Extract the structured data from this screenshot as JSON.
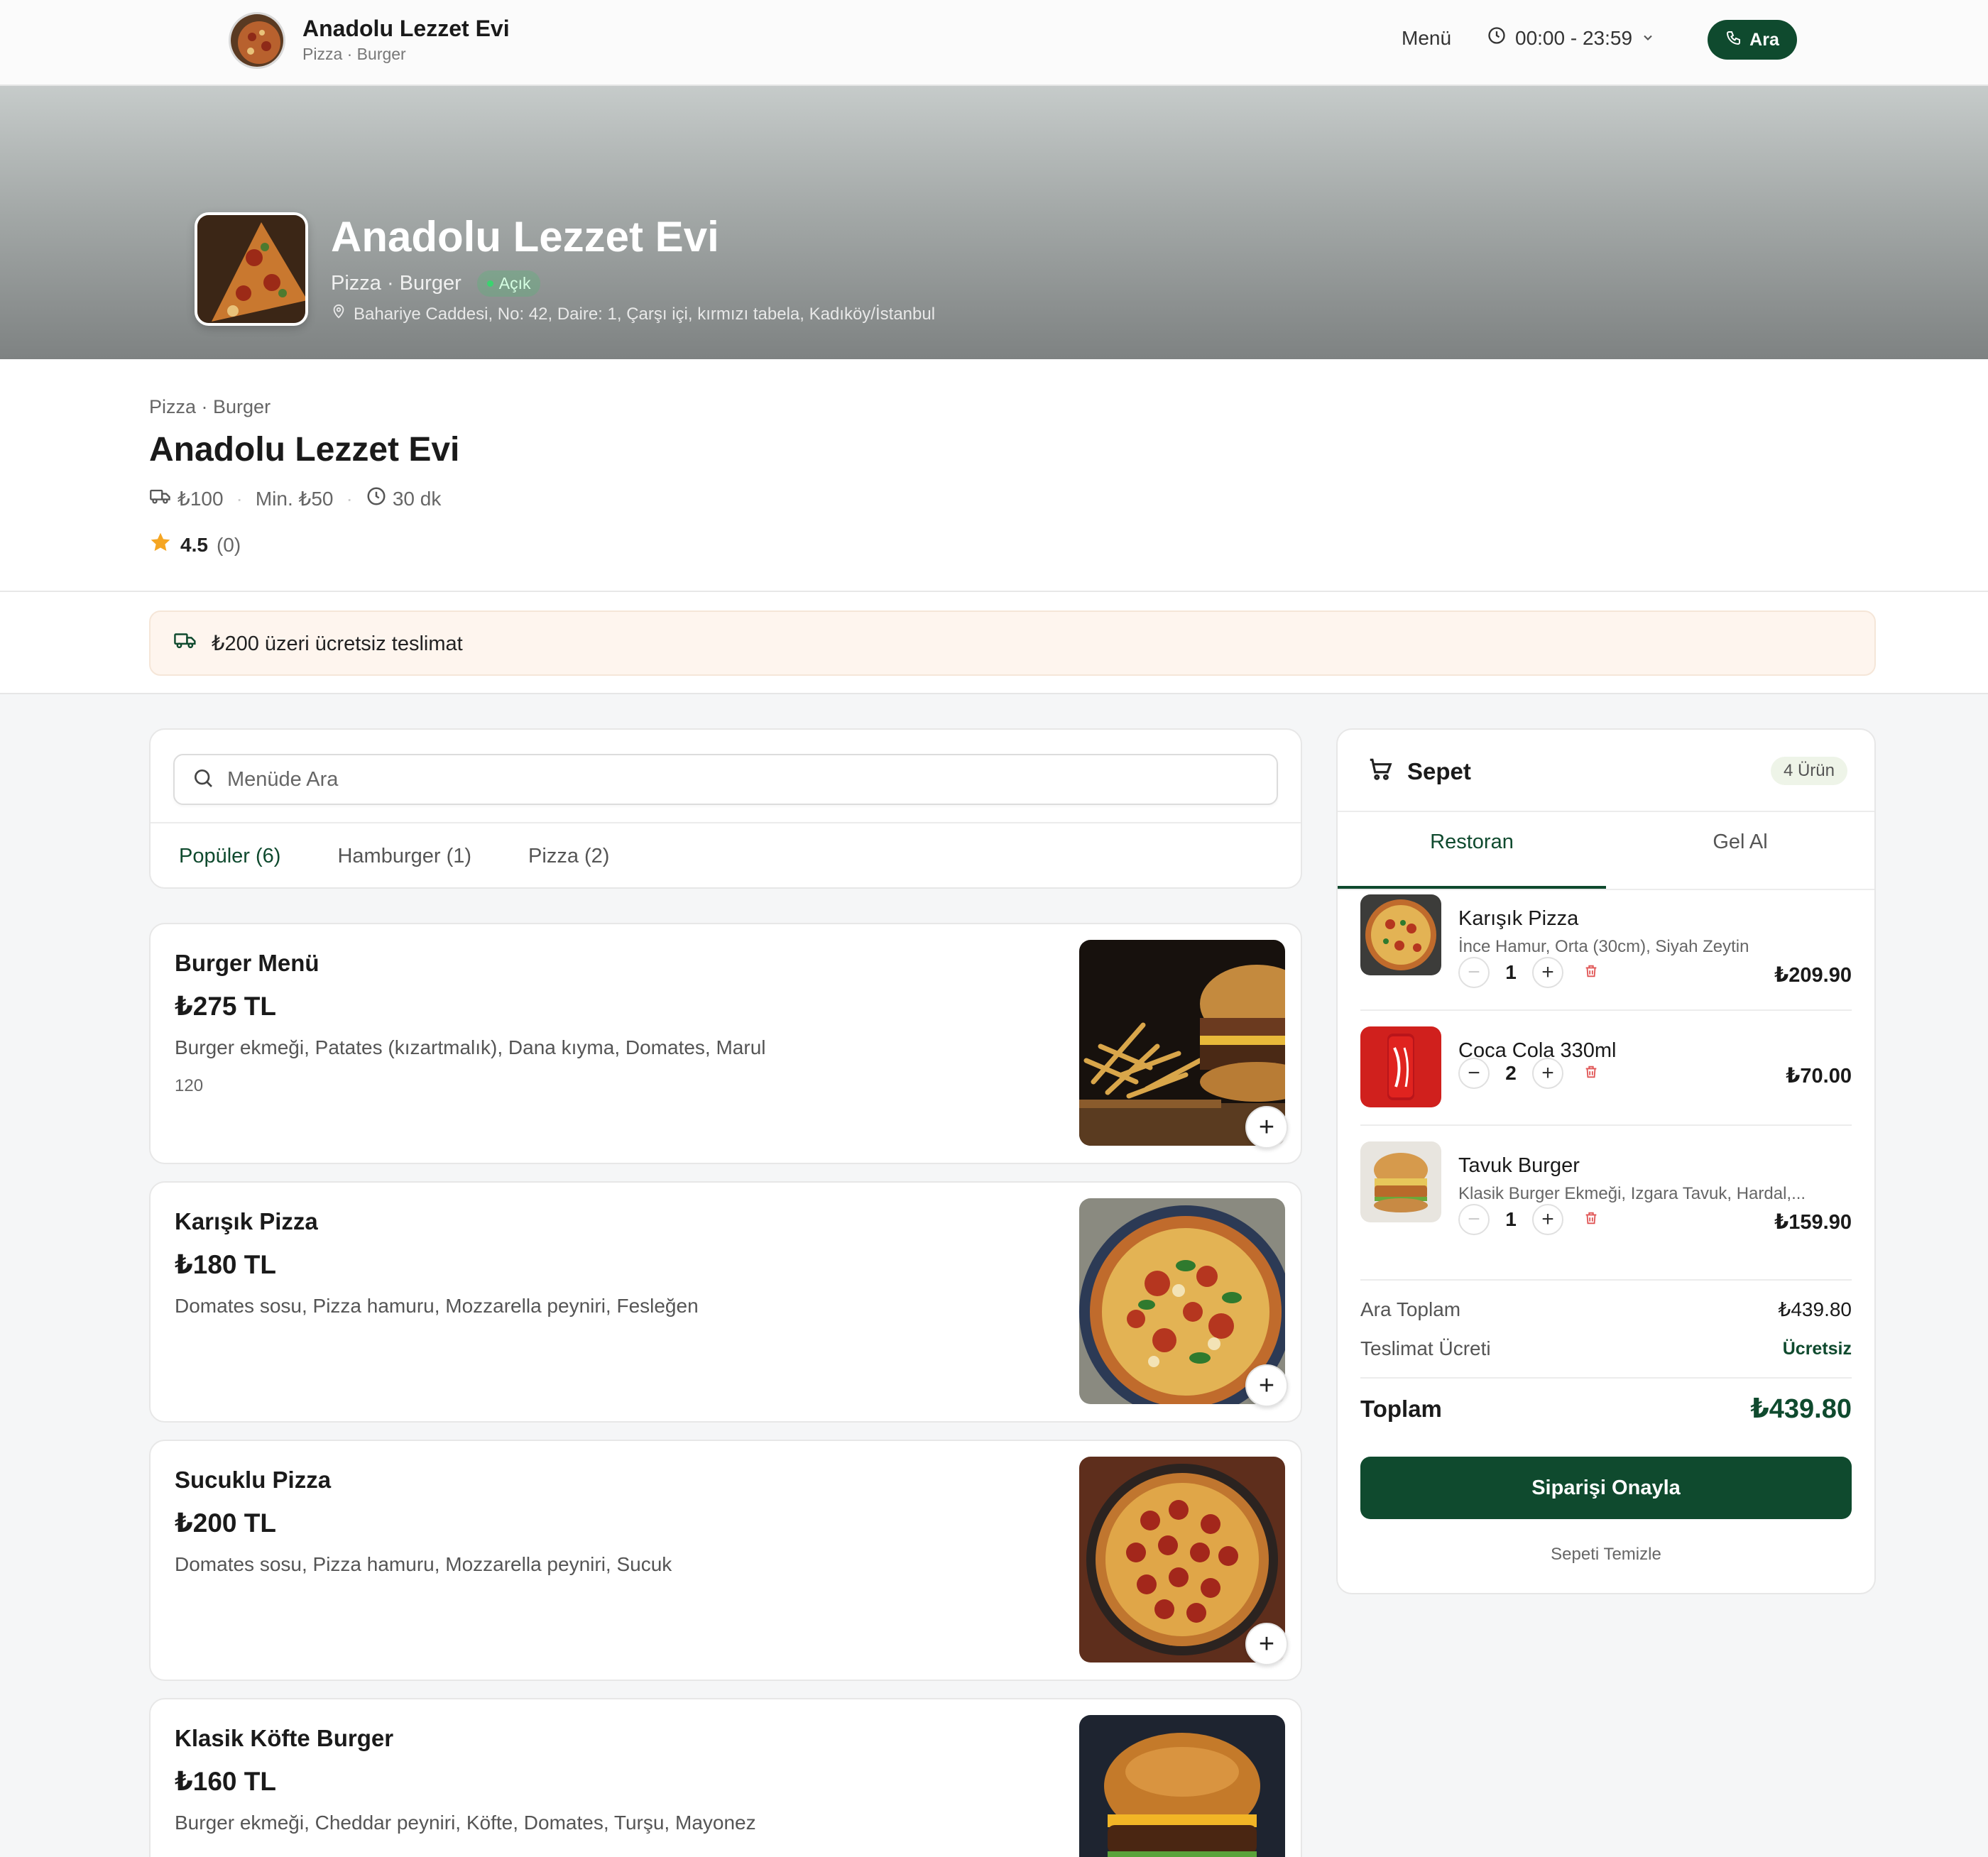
{
  "topbar": {
    "brand_name": "Anadolu Lezzet Evi",
    "brand_sub": "Pizza · Burger",
    "menu_label": "Menü",
    "hours": "00:00 - 23:59",
    "call_label": "Ara"
  },
  "hero": {
    "title": "Anadolu Lezzet Evi",
    "categories": "Pizza · Burger",
    "status": "Açık",
    "address": "Bahariye Caddesi, No: 42, Daire: 1, Çarşı içi, kırmızı tabela, Kadıköy/İstanbul"
  },
  "info": {
    "categories": "Pizza · Burger",
    "name": "Anadolu Lezzet Evi",
    "delivery_fee": "₺100",
    "min_order": "Min. ₺50",
    "delivery_time": "30 dk",
    "rating": "4.5",
    "rating_count": "(0)"
  },
  "promo": {
    "text": "₺200 üzeri ücretsiz teslimat"
  },
  "search": {
    "placeholder": "Menüde Ara"
  },
  "tabs": [
    {
      "label": "Popüler (6)",
      "active": true
    },
    {
      "label": "Hamburger (1)",
      "active": false
    },
    {
      "label": "Pizza (2)",
      "active": false
    }
  ],
  "products": [
    {
      "name": "Burger Menü",
      "price": "₺275 TL",
      "description": "Burger ekmeği, Patates (kızartmalık), Dana kıyma, Domates, Marul",
      "extra": "120",
      "image": "burger-fries-photo"
    },
    {
      "name": "Karışık Pizza",
      "price": "₺180 TL",
      "description": "Domates sosu, Pizza hamuru, Mozzarella peyniri, Fesleğen",
      "extra": "",
      "image": "margherita-pizza-photo"
    },
    {
      "name": "Sucuklu Pizza",
      "price": "₺200 TL",
      "description": "Domates sosu, Pizza hamuru, Mozzarella peyniri, Sucuk",
      "extra": "",
      "image": "pepperoni-pizza-photo"
    },
    {
      "name": "Klasik Köfte Burger",
      "price": "₺160 TL",
      "description": "Burger ekmeği, Cheddar peyniri, Köfte, Domates, Turşu, Mayonez",
      "extra": "",
      "image": "cheeseburger-photo"
    }
  ],
  "cart": {
    "title": "Sepet",
    "count_badge": "4 Ürün",
    "tabs": [
      {
        "label": "Restoran",
        "active": true
      },
      {
        "label": "Gel Al",
        "active": false
      }
    ],
    "items": [
      {
        "name": "Karışık Pizza",
        "options": "İnce Hamur, Orta (30cm), Siyah Zeytin",
        "qty": "1",
        "price": "₺209.90",
        "image": "pizza-thumb"
      },
      {
        "name": "Coca Cola 330ml",
        "options": "",
        "qty": "2",
        "price": "₺70.00",
        "image": "cola-can-thumb"
      },
      {
        "name": "Tavuk Burger",
        "options": "Klasik Burger Ekmeği, Izgara Tavuk, Hardal,...",
        "qty": "1",
        "price": "₺159.90",
        "image": "chicken-burger-thumb"
      }
    ],
    "subtotal_label": "Ara Toplam",
    "subtotal": "₺439.80",
    "delivery_label": "Teslimat Ücreti",
    "delivery_value": "Ücretsiz",
    "total_label": "Toplam",
    "total": "₺439.80",
    "confirm_label": "Siparişi Onayla",
    "clear_label": "Sepeti Temizle"
  },
  "colors": {
    "primary": "#0f4a2e",
    "delete": "#e05555",
    "star": "#f5a623",
    "promo_bg": "#fef5ee"
  }
}
